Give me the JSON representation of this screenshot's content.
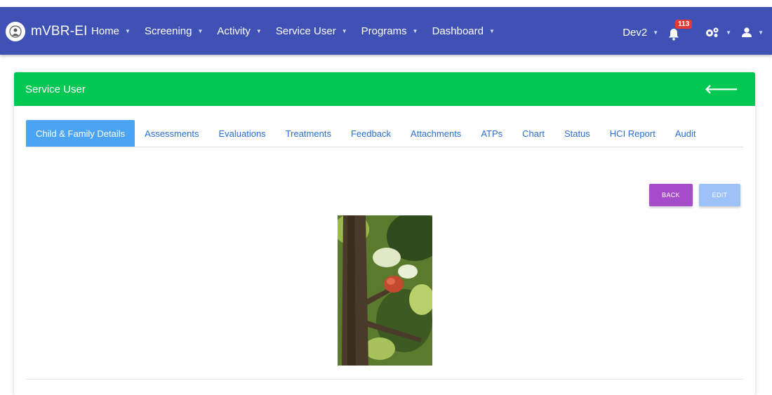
{
  "brand": {
    "name": "mVBR-EI",
    "logo_icon": "emblem-icon"
  },
  "nav": {
    "items": [
      {
        "label": "Home"
      },
      {
        "label": "Screening"
      },
      {
        "label": "Activity"
      },
      {
        "label": "Service User"
      },
      {
        "label": "Programs"
      },
      {
        "label": "Dashboard"
      }
    ],
    "user": "Dev2",
    "notifications_count": "113",
    "colors": {
      "navbar": "#3f51b5",
      "badge": "#e53935"
    }
  },
  "card": {
    "title": "Service User",
    "header_color": "#00c853",
    "tabs": [
      {
        "label": "Child & Family Details",
        "active": true
      },
      {
        "label": "Assessments"
      },
      {
        "label": "Evaluations"
      },
      {
        "label": "Treatments"
      },
      {
        "label": "Feedback"
      },
      {
        "label": "Attachments"
      },
      {
        "label": "ATPs"
      },
      {
        "label": "Chart"
      },
      {
        "label": "Status"
      },
      {
        "label": "HCI Report"
      },
      {
        "label": "Audit"
      }
    ],
    "buttons": {
      "back": "BACK",
      "edit": "EDIT"
    },
    "button_colors": {
      "back": "#a64bc9",
      "edit": "#9dc2f7"
    }
  }
}
